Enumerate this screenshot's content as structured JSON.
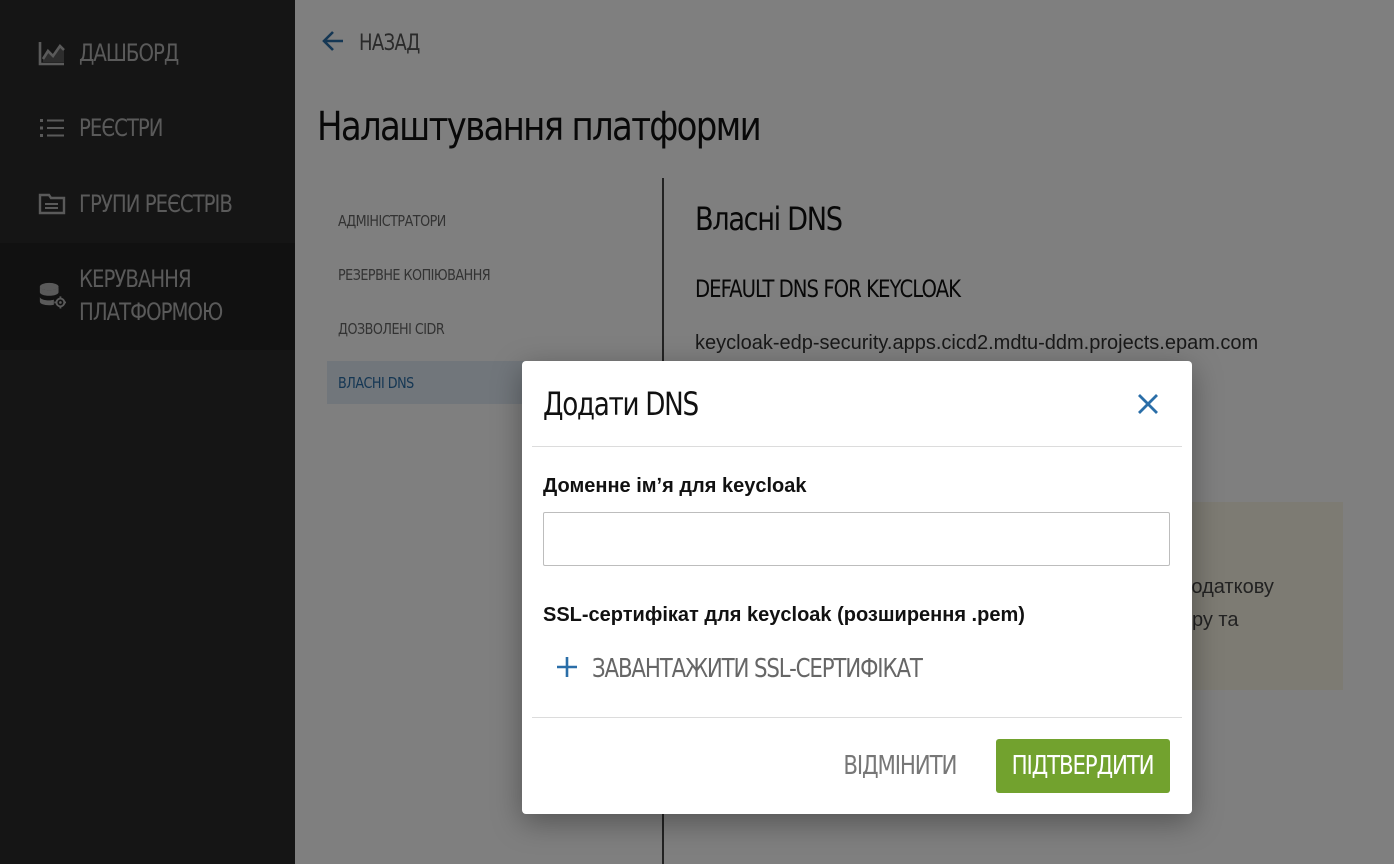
{
  "colors": {
    "accent": "#2a6ea8",
    "sidebar_bg": "#2b2b2b",
    "confirm_button": "#72a22e"
  },
  "sidebar": {
    "items": [
      {
        "label": "ДАШБОРД",
        "icon": "chart-icon"
      },
      {
        "label": "РЕЄСТРИ",
        "icon": "list-icon"
      },
      {
        "label": "ГРУПИ РЕЄСТРІВ",
        "icon": "folder-icon"
      },
      {
        "label": "КЕРУВАННЯ ПЛАТФОРМОЮ",
        "icon": "database-settings-icon",
        "active": true
      }
    ]
  },
  "header": {
    "back_label": "НАЗАД",
    "title": "Налаштування платформи"
  },
  "subnav": {
    "items": [
      {
        "label": "АДМІНІСТРАТОРИ"
      },
      {
        "label": "РЕЗЕРВНЕ КОПІЮВАННЯ"
      },
      {
        "label": "ДОЗВОЛЕНІ CIDR"
      },
      {
        "label": "ВЛАСНІ DNS",
        "active": true
      }
    ]
  },
  "content": {
    "section_title": "Власні DNS",
    "default_dns_heading": "DEFAULT DNS FOR KEYCLOAK",
    "default_dns_value": "keycloak-edp-security.apps.cicd2.mdtu-ddm.projects.epam.com",
    "info_line_1": "и додаткову",
    "info_line_2": "геру та"
  },
  "dialog": {
    "title": "Додати DNS",
    "domain_label": "Доменне імʼя для keycloak",
    "domain_value": "",
    "ssl_label": "SSL-сертифікат для keycloak (розширення .pem)",
    "upload_label": "ЗАВАНТАЖИТИ SSL-СЕРТИФІКАТ",
    "cancel_label": "ВІДМІНИТИ",
    "confirm_label": "ПІДТВЕРДИТИ"
  }
}
